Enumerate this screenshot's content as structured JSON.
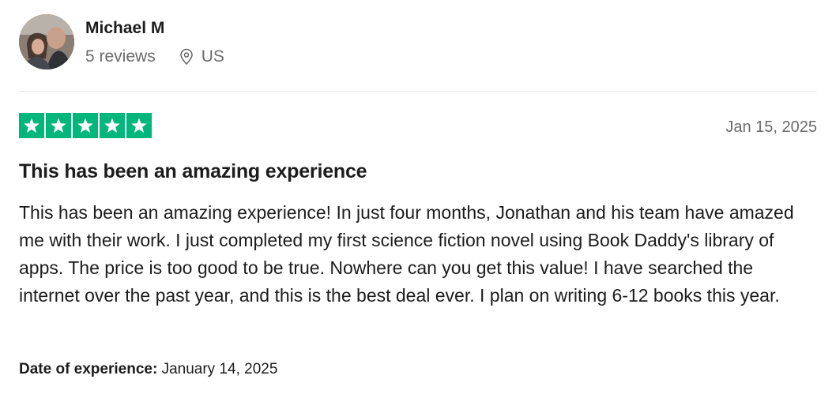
{
  "reviewer": {
    "name": "Michael M",
    "reviews": "5 reviews",
    "country": "US",
    "avatar_icon": "user-photo-avatar",
    "location_icon": "map-pin-icon"
  },
  "review": {
    "rating": 5,
    "rating_max": 5,
    "star_color": "#00b67a",
    "date": "Jan 15, 2025",
    "title": "This has been an amazing experience",
    "text": "This has been an amazing experience! In just four months, Jonathan and his team have amazed me with their work. I just completed my first science fiction novel using Book Daddy's library of apps. The price is too good to be true. Nowhere can you get this value! I have searched the internet over the past year, and this is the best deal ever. I plan on writing 6-12 books this year.",
    "experience_label": "Date of experience:",
    "experience_date": "January 14, 2025"
  }
}
